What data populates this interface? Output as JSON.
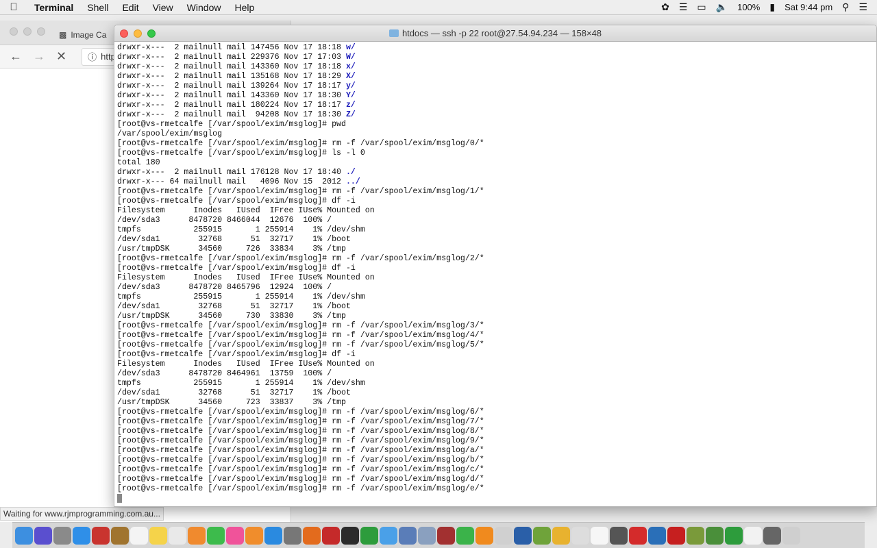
{
  "menubar": {
    "app_name": "Terminal",
    "menus": [
      "Shell",
      "Edit",
      "View",
      "Window",
      "Help"
    ],
    "battery": "100%",
    "clock": "Sat 9:44 pm"
  },
  "browser": {
    "tab_title": "Image Ca",
    "url_partial": "http",
    "status_text": "Waiting for www.rjmprogramming.com.au..."
  },
  "terminal": {
    "window_title": "htdocs — ssh -p 22 root@27.54.94.234 — 158×48",
    "lines": [
      {
        "text": "drwxr-x---  2 mailnull mail 147456 Nov 17 18:18 ",
        "dir": "w/"
      },
      {
        "text": "drwxr-x---  2 mailnull mail 229376 Nov 17 17:03 ",
        "dir": "W/"
      },
      {
        "text": "drwxr-x---  2 mailnull mail 143360 Nov 17 18:18 ",
        "dir": "x/"
      },
      {
        "text": "drwxr-x---  2 mailnull mail 135168 Nov 17 18:29 ",
        "dir": "X/"
      },
      {
        "text": "drwxr-x---  2 mailnull mail 139264 Nov 17 18:17 ",
        "dir": "y/"
      },
      {
        "text": "drwxr-x---  2 mailnull mail 143360 Nov 17 18:30 ",
        "dir": "Y/"
      },
      {
        "text": "drwxr-x---  2 mailnull mail 180224 Nov 17 18:17 ",
        "dir": "z/"
      },
      {
        "text": "drwxr-x---  2 mailnull mail  94208 Nov 17 18:30 ",
        "dir": "Z/"
      },
      {
        "text": "[root@vs-rmetcalfe [/var/spool/exim/msglog]# pwd",
        "dir": ""
      },
      {
        "text": "/var/spool/exim/msglog",
        "dir": ""
      },
      {
        "text": "[root@vs-rmetcalfe [/var/spool/exim/msglog]# rm -f /var/spool/exim/msglog/0/*",
        "dir": ""
      },
      {
        "text": "[root@vs-rmetcalfe [/var/spool/exim/msglog]# ls -l 0",
        "dir": ""
      },
      {
        "text": "total 180",
        "dir": ""
      },
      {
        "text": "drwxr-x---  2 mailnull mail 176128 Nov 17 18:40 ",
        "dir": "./"
      },
      {
        "text": "drwxr-x--- 64 mailnull mail   4096 Nov 15  2012 ",
        "dir": "../"
      },
      {
        "text": "[root@vs-rmetcalfe [/var/spool/exim/msglog]# rm -f /var/spool/exim/msglog/1/*",
        "dir": ""
      },
      {
        "text": "[root@vs-rmetcalfe [/var/spool/exim/msglog]# df -i",
        "dir": ""
      },
      {
        "text": "Filesystem      Inodes   IUsed  IFree IUse% Mounted on",
        "dir": ""
      },
      {
        "text": "/dev/sda3      8478720 8466044  12676  100% /",
        "dir": ""
      },
      {
        "text": "tmpfs           255915       1 255914    1% /dev/shm",
        "dir": ""
      },
      {
        "text": "/dev/sda1        32768      51  32717    1% /boot",
        "dir": ""
      },
      {
        "text": "/usr/tmpDSK      34560     726  33834    3% /tmp",
        "dir": ""
      },
      {
        "text": "[root@vs-rmetcalfe [/var/spool/exim/msglog]# rm -f /var/spool/exim/msglog/2/*",
        "dir": ""
      },
      {
        "text": "[root@vs-rmetcalfe [/var/spool/exim/msglog]# df -i",
        "dir": ""
      },
      {
        "text": "Filesystem      Inodes   IUsed  IFree IUse% Mounted on",
        "dir": ""
      },
      {
        "text": "/dev/sda3      8478720 8465796  12924  100% /",
        "dir": ""
      },
      {
        "text": "tmpfs           255915       1 255914    1% /dev/shm",
        "dir": ""
      },
      {
        "text": "/dev/sda1        32768      51  32717    1% /boot",
        "dir": ""
      },
      {
        "text": "/usr/tmpDSK      34560     730  33830    3% /tmp",
        "dir": ""
      },
      {
        "text": "[root@vs-rmetcalfe [/var/spool/exim/msglog]# rm -f /var/spool/exim/msglog/3/*",
        "dir": ""
      },
      {
        "text": "[root@vs-rmetcalfe [/var/spool/exim/msglog]# rm -f /var/spool/exim/msglog/4/*",
        "dir": ""
      },
      {
        "text": "[root@vs-rmetcalfe [/var/spool/exim/msglog]# rm -f /var/spool/exim/msglog/5/*",
        "dir": ""
      },
      {
        "text": "[root@vs-rmetcalfe [/var/spool/exim/msglog]# df -i",
        "dir": ""
      },
      {
        "text": "Filesystem      Inodes   IUsed  IFree IUse% Mounted on",
        "dir": ""
      },
      {
        "text": "/dev/sda3      8478720 8464961  13759  100% /",
        "dir": ""
      },
      {
        "text": "tmpfs           255915       1 255914    1% /dev/shm",
        "dir": ""
      },
      {
        "text": "/dev/sda1        32768      51  32717    1% /boot",
        "dir": ""
      },
      {
        "text": "/usr/tmpDSK      34560     723  33837    3% /tmp",
        "dir": ""
      },
      {
        "text": "[root@vs-rmetcalfe [/var/spool/exim/msglog]# rm -f /var/spool/exim/msglog/6/*",
        "dir": ""
      },
      {
        "text": "[root@vs-rmetcalfe [/var/spool/exim/msglog]# rm -f /var/spool/exim/msglog/7/*",
        "dir": ""
      },
      {
        "text": "[root@vs-rmetcalfe [/var/spool/exim/msglog]# rm -f /var/spool/exim/msglog/8/*",
        "dir": ""
      },
      {
        "text": "[root@vs-rmetcalfe [/var/spool/exim/msglog]# rm -f /var/spool/exim/msglog/9/*",
        "dir": ""
      },
      {
        "text": "[root@vs-rmetcalfe [/var/spool/exim/msglog]# rm -f /var/spool/exim/msglog/a/*",
        "dir": ""
      },
      {
        "text": "[root@vs-rmetcalfe [/var/spool/exim/msglog]# rm -f /var/spool/exim/msglog/b/*",
        "dir": ""
      },
      {
        "text": "[root@vs-rmetcalfe [/var/spool/exim/msglog]# rm -f /var/spool/exim/msglog/c/*",
        "dir": ""
      },
      {
        "text": "[root@vs-rmetcalfe [/var/spool/exim/msglog]# rm -f /var/spool/exim/msglog/d/*",
        "dir": ""
      },
      {
        "text": "[root@vs-rmetcalfe [/var/spool/exim/msglog]# rm -f /var/spool/exim/msglog/e/*",
        "dir": ""
      }
    ]
  },
  "dock": {
    "icons": [
      {
        "name": "finder-icon",
        "color": "#3d8fe0"
      },
      {
        "name": "siri-icon",
        "color": "#5a4fcf"
      },
      {
        "name": "launchpad-icon",
        "color": "#8a8a8a"
      },
      {
        "name": "safari-icon",
        "color": "#2f8fe8"
      },
      {
        "name": "photo-booth-icon",
        "color": "#c9342f"
      },
      {
        "name": "notes-book-icon",
        "color": "#a0742f"
      },
      {
        "name": "calendar-icon",
        "color": "#f4f4f4"
      },
      {
        "name": "notes-icon",
        "color": "#f5d34a"
      },
      {
        "name": "reminders-icon",
        "color": "#e9e9e9"
      },
      {
        "name": "photos-icon",
        "color": "#f08a2e"
      },
      {
        "name": "messages-icon",
        "color": "#3dbb4c"
      },
      {
        "name": "music-icon",
        "color": "#f0539a"
      },
      {
        "name": "ibooks-icon",
        "color": "#f08d2c"
      },
      {
        "name": "app-store-icon",
        "color": "#2a8ae0"
      },
      {
        "name": "system-preferences-icon",
        "color": "#777777"
      },
      {
        "name": "firefox-icon",
        "color": "#e36b1d"
      },
      {
        "name": "filezilla-icon",
        "color": "#c52a2a"
      },
      {
        "name": "terminal-icon",
        "color": "#2b2b2b"
      },
      {
        "name": "dreamweaver-icon",
        "color": "#2d9c3c"
      },
      {
        "name": "xcode-icon",
        "color": "#4aa0e8"
      },
      {
        "name": "coda-icon",
        "color": "#5a7db8"
      },
      {
        "name": "preview-icon",
        "color": "#8aa0bf"
      },
      {
        "name": "photo-booth-2-icon",
        "color": "#a23030"
      },
      {
        "name": "facetime-icon",
        "color": "#3bb34a"
      },
      {
        "name": "vlc-icon",
        "color": "#f08a1e"
      },
      {
        "name": "x11-icon",
        "color": "#d0d0d0"
      },
      {
        "name": "quicktime-icon",
        "color": "#2a5fa8"
      },
      {
        "name": "android-studio-icon",
        "color": "#6fa33a"
      },
      {
        "name": "android-icon",
        "color": "#e8b22f"
      },
      {
        "name": "screenflow-icon",
        "color": "#dddddd"
      },
      {
        "name": "textedit-icon",
        "color": "#f6f6f6"
      },
      {
        "name": "gimp-icon",
        "color": "#555555"
      },
      {
        "name": "opera-icon",
        "color": "#d42b2b"
      },
      {
        "name": "vscode-icon",
        "color": "#2a6fb8"
      },
      {
        "name": "acrobat-icon",
        "color": "#c61f1f"
      },
      {
        "name": "colorpicker-icon",
        "color": "#7a9a3a"
      },
      {
        "name": "chrome-icon",
        "color": "#4a8f3a"
      },
      {
        "name": "dreamweaver-2-icon",
        "color": "#2d9c3c"
      },
      {
        "name": "document-icon",
        "color": "#f2f2f2"
      },
      {
        "name": "keyboard-icon",
        "color": "#666666"
      },
      {
        "name": "trash-icon",
        "color": "#cfcfcf"
      }
    ]
  }
}
